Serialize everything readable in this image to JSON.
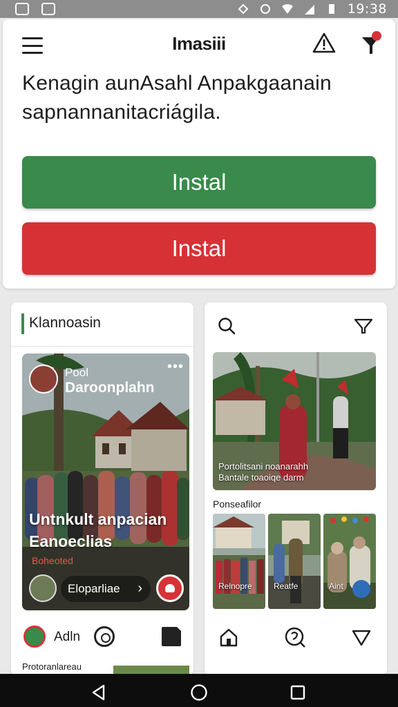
{
  "status_bar": {
    "time": "19:38"
  },
  "header": {
    "app_title": "Imasiii"
  },
  "headline": "Kenagin aunAsahl Anpakgaanain sapnannanitacriágila.",
  "buttons": {
    "primary_label": "Instal",
    "secondary_label": "Instal"
  },
  "colors": {
    "green": "#3a8a4b",
    "red": "#d63236",
    "accent_blue": "#2f6db8"
  },
  "left_card": {
    "title": "Klannoasin",
    "post_name_small": "Pool",
    "post_name": "Daroonplahn",
    "more_label": "•••",
    "caption": "Untnkult anpacian Eanoeclias",
    "tag": "Boheoted",
    "pill_label": "Eloparliae",
    "action_label": "Adln",
    "footer_text": "Protoranlareau"
  },
  "right_card": {
    "hero_caption_line1": "Portolitsani noanarahh",
    "hero_caption_line2": "Bantale toaoiqe darm",
    "section_title": "Ponseafilor",
    "thumbs": [
      "Relnopre",
      "Reatfe",
      "Aint"
    ]
  },
  "icons": {
    "menu": "hamburger-icon",
    "warning": "warning-icon",
    "notification": "notification-pin-icon",
    "search": "search-icon",
    "filter": "filter-icon",
    "home": "home-icon",
    "heart": "heart-icon",
    "back": "back-icon",
    "nav_home": "nav-home-icon",
    "recents": "recents-icon"
  }
}
